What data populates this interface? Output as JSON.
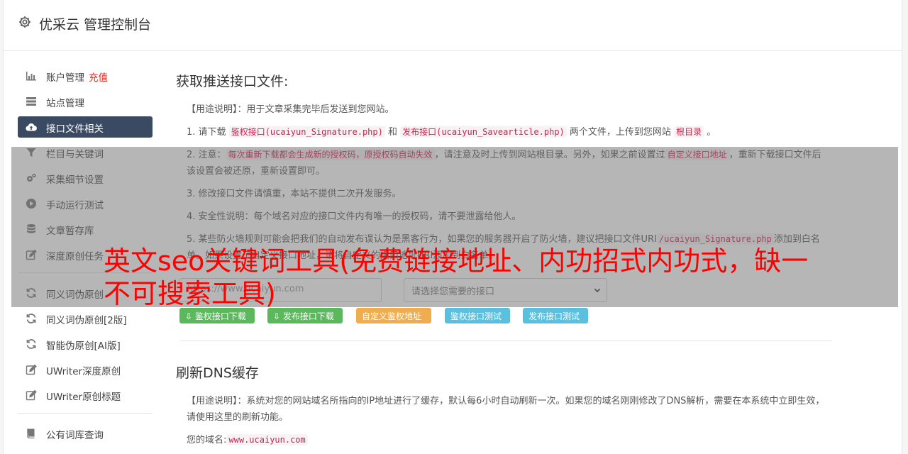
{
  "header": {
    "title": "优采云 管理控制台"
  },
  "sidebar": {
    "group1": [
      {
        "label": "账户管理",
        "extra": "充值",
        "icon": "bar-chart-icon"
      },
      {
        "label": "站点管理",
        "icon": "server-icon"
      },
      {
        "label": "接口文件相关",
        "icon": "cloud-upload-icon",
        "active": true
      },
      {
        "label": "栏目与关键词",
        "icon": "filter-icon"
      },
      {
        "label": "采集细节设置",
        "icon": "cogs-icon"
      },
      {
        "label": "手动运行测试",
        "icon": "play-circle-icon"
      },
      {
        "label": "文章暂存库",
        "icon": "database-icon"
      },
      {
        "label": "深度原创任务",
        "icon": "edit-icon"
      }
    ],
    "group2": [
      {
        "label": "同义词伪原创",
        "icon": "refresh-icon"
      },
      {
        "label": "同义词伪原创[2版]",
        "icon": "refresh-icon"
      },
      {
        "label": "智能伪原创[AI版]",
        "icon": "refresh-icon"
      },
      {
        "label": "UWriter深度原创",
        "icon": "edit-icon"
      },
      {
        "label": "UWriter原创标题",
        "icon": "edit-icon"
      }
    ],
    "group3": [
      {
        "label": "公有词库查询",
        "icon": "book-icon"
      }
    ]
  },
  "section1": {
    "title": "获取推送接口文件:",
    "usage": "【用途说明】：用于文章采集完毕后发送到您网站。",
    "item1": {
      "p1": "1. 请下载",
      "c1": "鉴权接口(ucaiyun_Signature.php)",
      "p2": "和",
      "c2": "发布接口(ucaiyun_Savearticle.php)",
      "p3": "两个文件，上传到您网站",
      "c3": "根目录",
      "p4": "。"
    },
    "item2": {
      "p1": "2. 注意：",
      "c1": "每次重新下载都会生成新的授权码，原授权码自动失效",
      "p2": "，请注意及时上传到网站根目录。另外，如果之前设置过",
      "c2": "自定义接口地址",
      "p3": "，重新下载接口文件后该设置会被还原，重新设置即可。"
    },
    "item3": "3. 修改接口文件请慎重，本站不提供二次开发服务。",
    "item4": "4. 安全性说明：每个域名对应的接口文件内有唯一的授权码，请不要泄露给他人。",
    "item5": {
      "p1": "5. 某些防火墙规则可能会把我们的自动发布误认为是黑客行为，如果您的服务器开启了防火墙，建议把接口文件URI",
      "c1": "/ucaiyun_Signature.php",
      "p2": "添加到白名单。如果设置了自定义接口地址，请将自定义的接口地址URI添加到白名单。"
    },
    "url_placeholder": "https://www.ucaiyun.com",
    "select_placeholder": "请选择您需要的接口",
    "buttons": {
      "auth_download": "鉴权接口下载",
      "publish_download": "发布接口下载",
      "custom_auth_url": "自定义鉴权地址",
      "auth_test": "鉴权接口测试",
      "publish_test": "发布接口测试"
    }
  },
  "section2": {
    "title": "刷新DNS缓存",
    "usage": "【用途说明】：系统对您的网站域名所指向的IP地址进行了缓存，默认每6小时自动刷新一次。如果您的域名刚刚修改了DNS解析，需要在本系统中立即生效，请使用这里的刷新功能。",
    "domain_label": "您的域名:",
    "domain_value": "www.ucaiyun.com"
  },
  "overlay_text": "英文seo关键词工具(免费链接地址、内功招式内功式，缺一不可搜索工具)",
  "colors": {
    "sidebar_active": "#3b4a63",
    "recharge_red": "#e2231a",
    "btn_green": "#5cb85c",
    "btn_orange": "#f0ad4e",
    "btn_blue": "#5bc0de",
    "overlay_text": "#ff0000"
  }
}
